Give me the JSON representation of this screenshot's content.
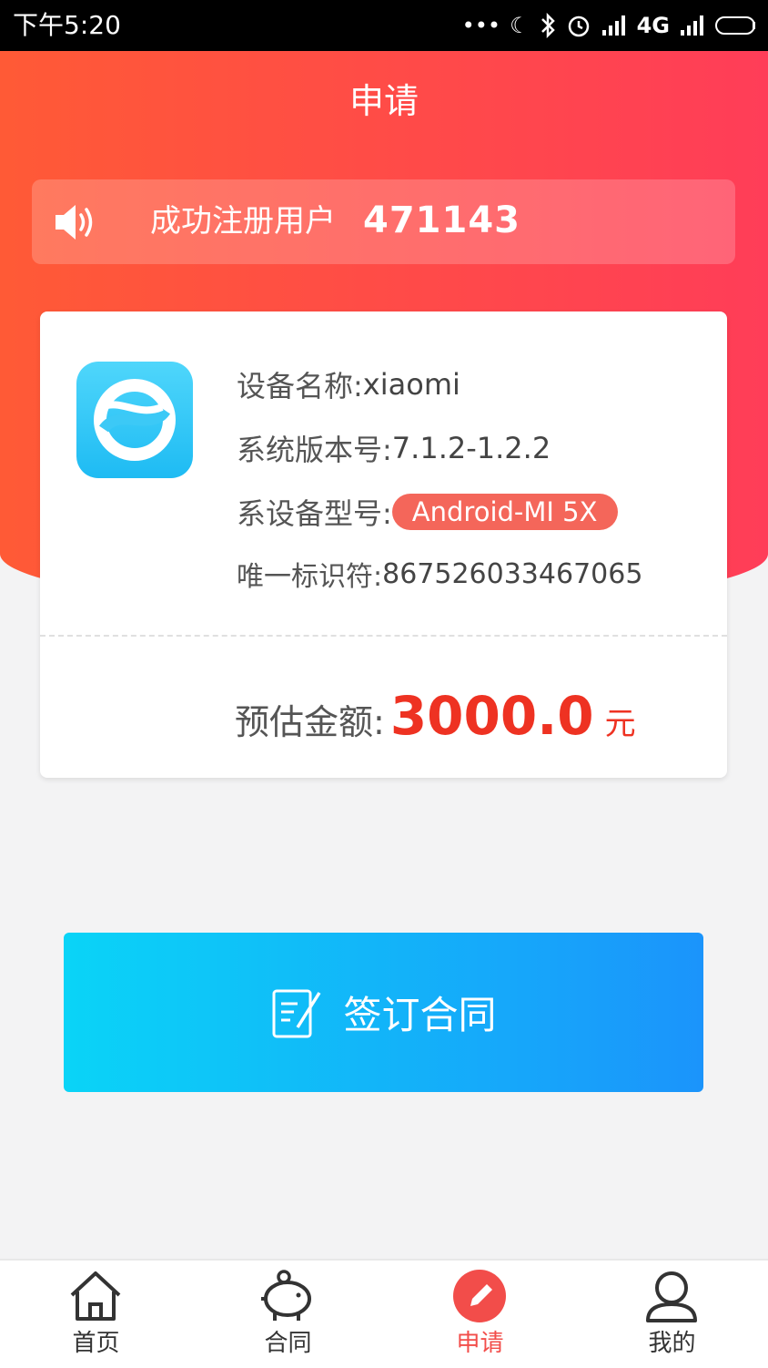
{
  "status_bar": {
    "time": "下午5:20",
    "network": "4G"
  },
  "header": {
    "title": "申请"
  },
  "notice": {
    "label": "成功注册用户",
    "count": "471143"
  },
  "device": {
    "name_label": "设备名称:",
    "name_value": "xiaomi",
    "version_label": "系统版本号:",
    "version_value": "7.1.2-1.2.2",
    "model_label": "系设备型号:",
    "model_value": "Android-MI 5X",
    "id_label": "唯一标识符:",
    "id_value": "867526033467065"
  },
  "estimate": {
    "label": "预估金额:",
    "value": "3000.0",
    "unit": "元"
  },
  "sign_button": {
    "label": "签订合同"
  },
  "tabs": [
    {
      "label": "首页",
      "icon": "home-icon"
    },
    {
      "label": "合同",
      "icon": "piggy-bank-icon"
    },
    {
      "label": "申请",
      "icon": "pencil-icon"
    },
    {
      "label": "我的",
      "icon": "user-icon"
    }
  ],
  "colors": {
    "accent_red": "#ff4545",
    "amount_red": "#ee3222",
    "button_blue": "#1b94fb",
    "active_tab": "#f24d4a"
  }
}
